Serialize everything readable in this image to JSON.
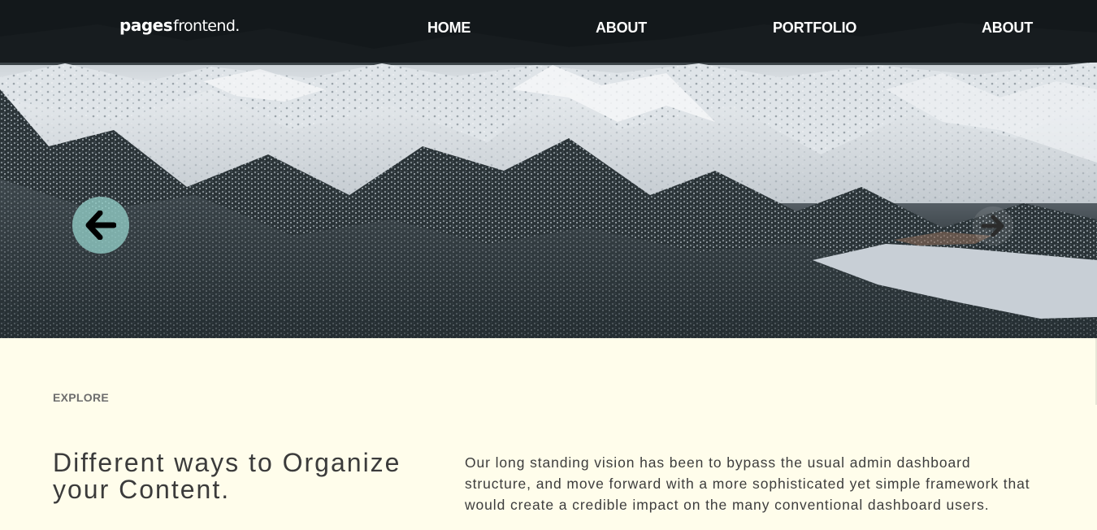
{
  "header": {
    "logo": {
      "bold": "pages",
      "light": "frontend."
    },
    "nav": [
      {
        "label": "HOME"
      },
      {
        "label": "ABOUT"
      },
      {
        "label": "PORTFOLIO"
      },
      {
        "label": "ABOUT"
      }
    ]
  },
  "hero": {
    "image": "snowy-mountain-forest-landscape",
    "prev_icon": "arrow-left-icon",
    "next_icon": "arrow-right-icon"
  },
  "content": {
    "eyebrow": "EXPLORE",
    "heading": "Different ways to Organize your Content.",
    "body": "Our long standing vision has been to bypass the usual admin dashboard structure, and move forward with a more sophisticated yet simple framework that would create a credible impact on the many conventional dashboard users."
  },
  "colors": {
    "navbar_bg": "#111619",
    "content_bg": "#fffdeb",
    "prev_arrow_bg": "#92cdc6",
    "heading_text": "#3b3b3b",
    "eyebrow_text": "#6d6d6d"
  }
}
